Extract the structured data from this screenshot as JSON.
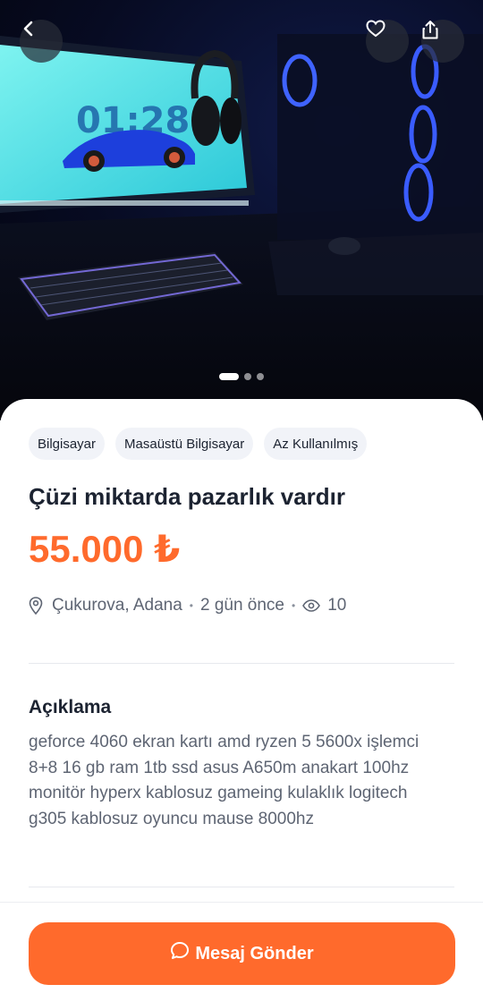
{
  "gallery": {
    "photo_description_icon": "image-icon",
    "screen_clock_text": "01:28",
    "slide_count": 3,
    "active_slide_index": 0
  },
  "header": {
    "back_icon": "chevron-left-icon",
    "favorite_icon": "heart-icon",
    "share_icon": "share-icon"
  },
  "tags": [
    "Bilgisayar",
    "Masaüstü Bilgisayar",
    "Az Kullanılmış"
  ],
  "listing": {
    "title": "Çüzi miktarda pazarlık vardır",
    "price": "55.000 ₺",
    "location": "Çukurova, Adana",
    "posted": "2 gün önce",
    "views": "10"
  },
  "description": {
    "heading": "Açıklama",
    "text": "geforce 4060 ekran kartı amd ryzen 5 5600x işlemci 8+8 16 gb ram 1tb ssd asus A650m anakart 100hz monitör hyperx kablosuz gameing kulaklık logitech g305 kablosuz oyuncu mause 8000hz"
  },
  "cta": {
    "label": "Mesaj Gönder",
    "icon": "chat-bubble-icon"
  },
  "colors": {
    "accent": "#ff6a2c",
    "text_primary": "#1c2331",
    "text_secondary": "#5e6573",
    "tag_bg": "#f1f3f8"
  }
}
